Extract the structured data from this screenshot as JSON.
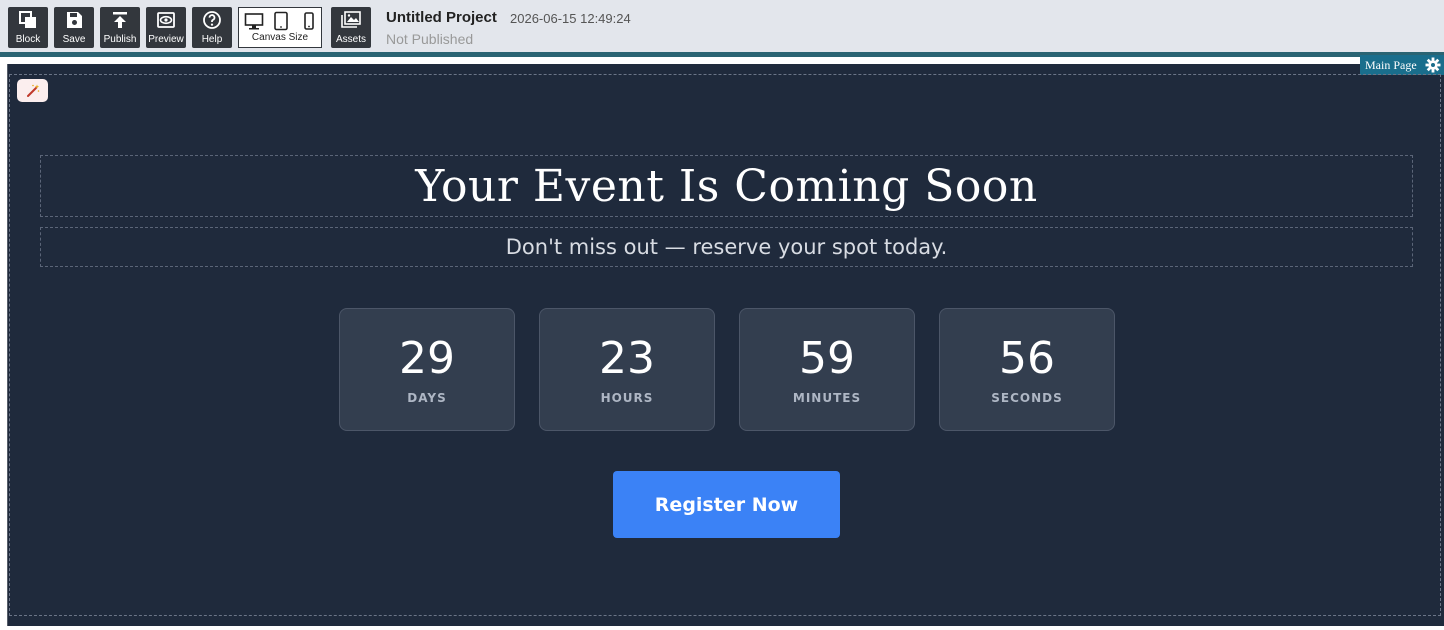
{
  "toolbar": {
    "buttons": [
      {
        "label": "Block",
        "icon": "copy-blocks-icon"
      },
      {
        "label": "Save",
        "icon": "floppy-disk-icon"
      },
      {
        "label": "Publish",
        "icon": "upload-arrow-icon"
      },
      {
        "label": "Preview",
        "icon": "eye-icon"
      },
      {
        "label": "Help",
        "icon": "question-circle-icon"
      }
    ],
    "canvas_size_label": "Canvas Size",
    "canvas_size_devices": [
      "desktop-icon",
      "tablet-icon",
      "mobile-icon"
    ],
    "assets_label": "Assets"
  },
  "project": {
    "title": "Untitled Project",
    "timestamp": "2026-06-15 12:49:24",
    "status": "Not Published"
  },
  "page_tab": {
    "label": "Main Page",
    "icon": "gear-icon"
  },
  "content": {
    "heading": "Your Event Is Coming Soon",
    "subheading": "Don't miss out — reserve your spot today.",
    "countdown": [
      {
        "value": "29",
        "unit": "DAYS"
      },
      {
        "value": "23",
        "unit": "HOURS"
      },
      {
        "value": "59",
        "unit": "MINUTES"
      },
      {
        "value": "56",
        "unit": "SECONDS"
      }
    ],
    "cta_label": "Register Now"
  },
  "colors": {
    "toolbar_bg": "#e3e6ec",
    "toolbar_button": "#33373d",
    "canvas_bg": "#1f2a3c",
    "card_bg": "#333e4f",
    "accent": "#3b82f6",
    "page_tab": "#1a6e8c"
  }
}
